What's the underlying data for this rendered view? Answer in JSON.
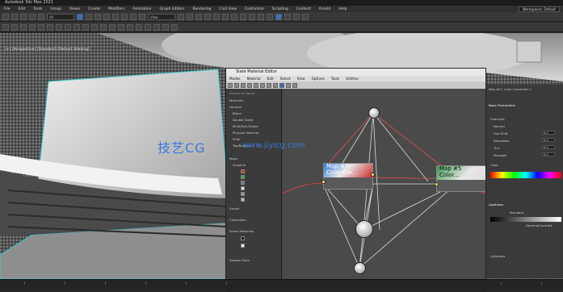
{
  "app": {
    "title": "Autodesk 3ds Max 2021"
  },
  "menu": [
    "File",
    "Edit",
    "Tools",
    "Group",
    "Views",
    "Create",
    "Modifiers",
    "Animation",
    "Graph Editors",
    "Rendering",
    "Civil View",
    "Customize",
    "Scripting",
    "Content",
    "Arnold",
    "Help"
  ],
  "workspace": "Workspaces: Default",
  "toolbar_selects": [
    "All",
    "View"
  ],
  "viewport": {
    "label": "[+] [Perspective] [Standard] [Default Shading]"
  },
  "slate": {
    "title": "Slate Material Editor",
    "menu": [
      "Modes",
      "Material",
      "Edit",
      "Select",
      "View",
      "Options",
      "Tools",
      "Utilities"
    ],
    "browser_search": "Search by Name ...",
    "browser_rows": [
      "Materials",
      "General",
      "Blend",
      "Double Sided",
      "Multi/Sub-Object",
      "Physical Material",
      "Shell",
      "Top/Bottom",
      "Maps",
      "Scanline",
      "Arnold",
      "Controllers",
      "Scene Materials",
      "Sample Slots"
    ],
    "nodes": {
      "left": {
        "title_line1": "Map #3",
        "title_line2": "Color Cor..."
      },
      "right": {
        "title_line1": "Map #5",
        "title_line2": "Color..."
      }
    }
  },
  "cmdpanel": {
    "header": "Map #5  ( Color Correction )",
    "section_basic": "Basic Parameters",
    "rows": [
      "Channels",
      "Normal",
      "Hue Shift",
      "Saturation",
      "Tint",
      "Strength",
      "Color",
      "Lightness"
    ],
    "values": [
      "0.0",
      "0.0",
      "0.0",
      "0.0"
    ],
    "section_lightness": "Lightness",
    "lightness_mode": "Standard",
    "gamma_label": "Gamma/Contrast"
  },
  "watermark": {
    "main": "技艺CG",
    "sub": "www.jiyicg.com"
  }
}
